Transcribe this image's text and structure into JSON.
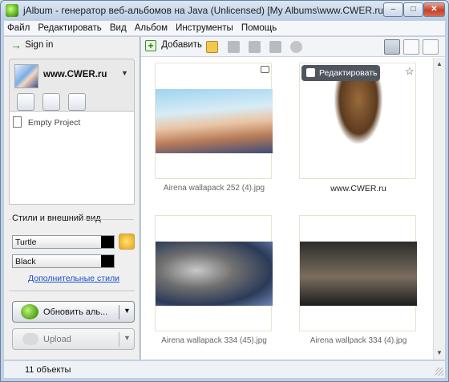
{
  "window": {
    "title": "jAlbum - генератор веб-альбомов на Java (Unlicensed) [My Albums\\www.CWER.ru]"
  },
  "menu": [
    "Файл",
    "Редактировать",
    "Вид",
    "Альбом",
    "Инструменты",
    "Помощь"
  ],
  "left": {
    "signin": "Sign in",
    "project_name": "www.CWER.ru",
    "empty_project": "Empty Project",
    "styles_section": "Стили и внешний вид",
    "style": "Turtle",
    "variant": "Black",
    "more_styles": "Дополнительные стили",
    "update_button": "Обновить аль...",
    "upload_button": "Upload"
  },
  "toolbar": {
    "add_label": "Добавить"
  },
  "grid": {
    "edit_label": "Редактировать",
    "items": [
      {
        "caption": "Airena wallapack 252 (4).jpg"
      },
      {
        "caption": "www.CWER.ru"
      },
      {
        "caption": "Airena wallapack 334 (45).jpg"
      },
      {
        "caption": "Airena wallpack 334 (4).jpg"
      }
    ]
  },
  "status": {
    "text": "11 объекты"
  },
  "colors": {
    "accent": "#1a4fd0",
    "titlebar": "#bccde3"
  }
}
